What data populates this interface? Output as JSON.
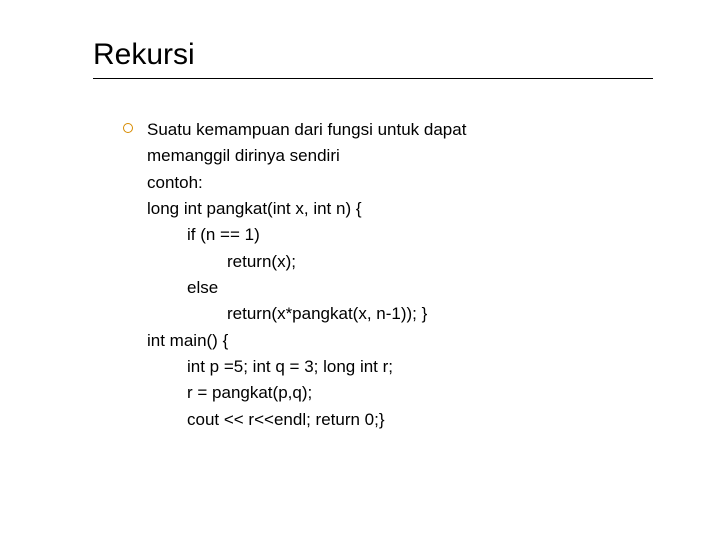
{
  "title": "Rekursi",
  "lines": [
    {
      "text": "Suatu kemampuan dari fungsi untuk dapat",
      "indent": ""
    },
    {
      "text": "memanggil dirinya sendiri",
      "indent": ""
    },
    {
      "text": "contoh:",
      "indent": ""
    },
    {
      "text": "long int pangkat(int x, int n) {",
      "indent": ""
    },
    {
      "text": "if (n == 1)",
      "indent": "i1"
    },
    {
      "text": "return(x);",
      "indent": "i2"
    },
    {
      "text": "else",
      "indent": "i1"
    },
    {
      "text": "return(x*pangkat(x, n-1)); }",
      "indent": "i2"
    },
    {
      "text": "int main() {",
      "indent": ""
    },
    {
      "text": "int p =5; int q = 3; long int r;",
      "indent": "i1"
    },
    {
      "text": "r = pangkat(p,q);",
      "indent": "i1"
    },
    {
      "text": "cout << r<<endl; return 0;}",
      "indent": "i1"
    }
  ]
}
